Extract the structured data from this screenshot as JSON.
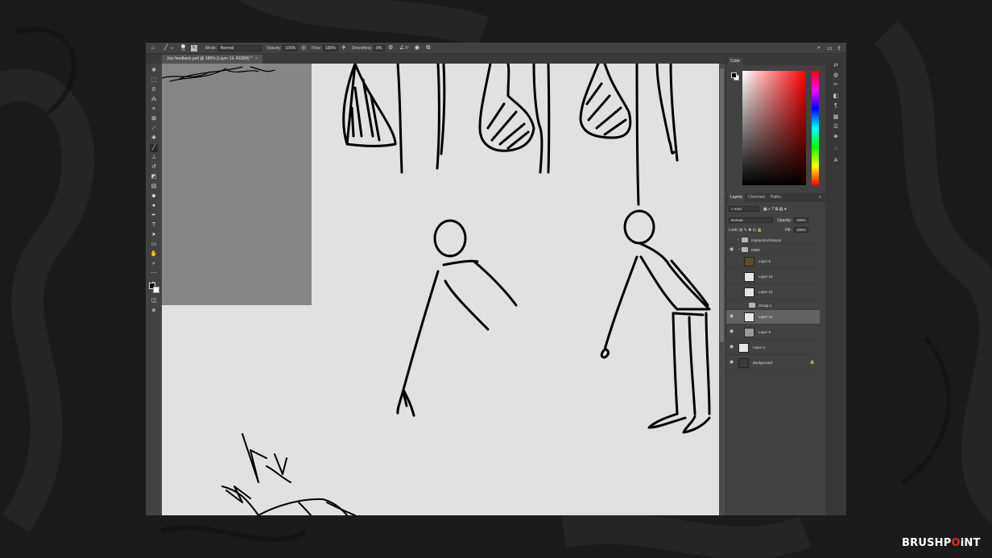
{
  "options_bar": {
    "brush_size": "35",
    "mode_label": "Mode:",
    "mode_value": "Normal",
    "opacity_label": "Opacity:",
    "opacity_value": "100%",
    "flow_label": "Flow:",
    "flow_value": "100%",
    "smoothing_label": "Smoothing:",
    "smoothing_value": "0%",
    "angle_value": "0°"
  },
  "document_tab": {
    "title": "July feedback.psd @ 186% (Layer 14, RGB/8) *",
    "close": "×"
  },
  "color_panel": {
    "tab": "Color",
    "foreground": "#000000",
    "background": "#ffffff"
  },
  "layers_panel": {
    "tabs": [
      "Layers",
      "Channels",
      "Paths"
    ],
    "filter_label": "Kind",
    "blend_mode": "Normal",
    "opacity_label": "Opacity:",
    "opacity_value": "100%",
    "lock_label": "Lock:",
    "fill_label": "Fill:",
    "fill_value": "100%",
    "layers": [
      {
        "name": "Impractical Rascal",
        "type": "group",
        "visible": false,
        "indent": 0
      },
      {
        "name": "Mikel",
        "type": "group",
        "visible": true,
        "indent": 0
      },
      {
        "name": "Layer 5",
        "type": "layer",
        "visible": false,
        "indent": 1
      },
      {
        "name": "Layer 13",
        "type": "layer",
        "visible": false,
        "indent": 1
      },
      {
        "name": "Layer 12",
        "type": "layer",
        "visible": false,
        "indent": 1
      },
      {
        "name": "Group 1",
        "type": "group",
        "visible": false,
        "indent": 1
      },
      {
        "name": "Layer 14",
        "type": "layer",
        "visible": true,
        "indent": 1,
        "selected": true
      },
      {
        "name": "Layer 6",
        "type": "layer",
        "visible": true,
        "indent": 1
      },
      {
        "name": "Layer 4",
        "type": "layer",
        "visible": true,
        "indent": 0
      },
      {
        "name": "Background",
        "type": "background",
        "visible": true,
        "indent": 0,
        "locked": true
      }
    ]
  },
  "watermark": {
    "part1": "BRUSHP",
    "part2": "O",
    "part3": "iNT"
  }
}
